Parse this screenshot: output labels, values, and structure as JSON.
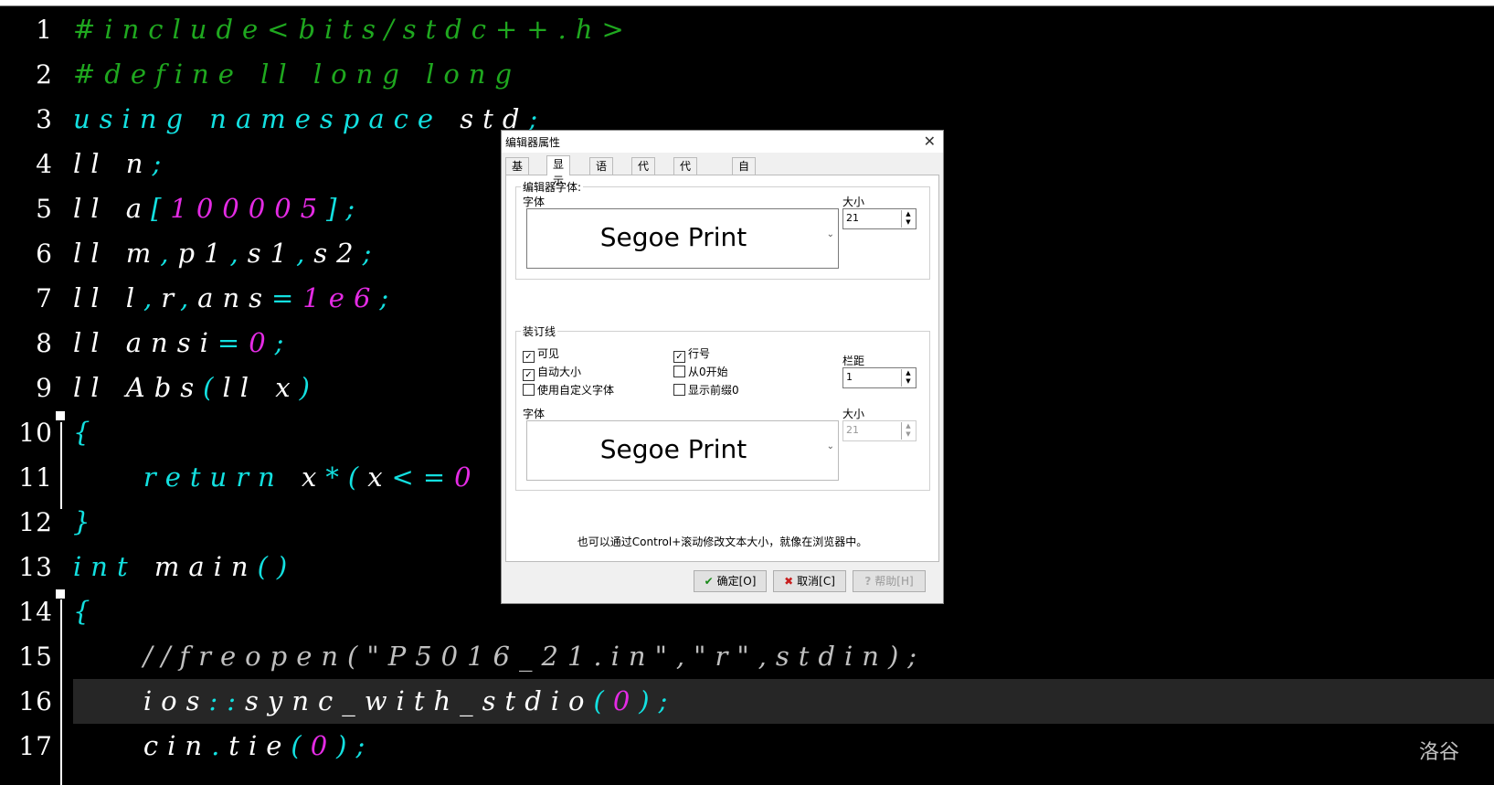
{
  "watermark": "洛谷",
  "code_lines": [
    {
      "num": "1",
      "tokens": [
        {
          "t": "#include<bits/stdc++.h>",
          "c": "pp"
        }
      ]
    },
    {
      "num": "2",
      "tokens": [
        {
          "t": "#define ll long long",
          "c": "pp"
        }
      ]
    },
    {
      "num": "3",
      "tokens": [
        {
          "t": "using namespace",
          "c": "kw"
        },
        {
          "t": " std",
          "c": "id"
        },
        {
          "t": ";",
          "c": "sym"
        }
      ]
    },
    {
      "num": "4",
      "tokens": [
        {
          "t": "ll n",
          "c": "id"
        },
        {
          "t": ";",
          "c": "sym"
        }
      ]
    },
    {
      "num": "5",
      "tokens": [
        {
          "t": "ll a",
          "c": "id"
        },
        {
          "t": "[",
          "c": "sym"
        },
        {
          "t": "100005",
          "c": "num"
        },
        {
          "t": "];",
          "c": "sym"
        }
      ]
    },
    {
      "num": "6",
      "tokens": [
        {
          "t": "ll m",
          "c": "id"
        },
        {
          "t": ",",
          "c": "sym"
        },
        {
          "t": "p1",
          "c": "id"
        },
        {
          "t": ",",
          "c": "sym"
        },
        {
          "t": "s1",
          "c": "id"
        },
        {
          "t": ",",
          "c": "sym"
        },
        {
          "t": "s2",
          "c": "id"
        },
        {
          "t": ";",
          "c": "sym"
        }
      ]
    },
    {
      "num": "7",
      "tokens": [
        {
          "t": "ll l",
          "c": "id"
        },
        {
          "t": ",",
          "c": "sym"
        },
        {
          "t": "r",
          "c": "id"
        },
        {
          "t": ",",
          "c": "sym"
        },
        {
          "t": "ans",
          "c": "id"
        },
        {
          "t": "=",
          "c": "sym"
        },
        {
          "t": "1e6",
          "c": "num"
        },
        {
          "t": ";",
          "c": "sym"
        }
      ]
    },
    {
      "num": "8",
      "tokens": [
        {
          "t": "ll ansi",
          "c": "id"
        },
        {
          "t": "=",
          "c": "sym"
        },
        {
          "t": "0",
          "c": "num"
        },
        {
          "t": ";",
          "c": "sym"
        }
      ]
    },
    {
      "num": "9",
      "tokens": [
        {
          "t": "ll Abs",
          "c": "id"
        },
        {
          "t": "(",
          "c": "sym"
        },
        {
          "t": "ll x",
          "c": "id"
        },
        {
          "t": ")",
          "c": "sym"
        }
      ]
    },
    {
      "num": "10",
      "tokens": [
        {
          "t": "{",
          "c": "sym"
        }
      ]
    },
    {
      "num": "11",
      "tokens": [
        {
          "t": "    return",
          "c": "kw"
        },
        {
          "t": " x",
          "c": "id"
        },
        {
          "t": "*(",
          "c": "sym"
        },
        {
          "t": "x",
          "c": "id"
        },
        {
          "t": "<=",
          "c": "sym"
        },
        {
          "t": "0",
          "c": "num"
        }
      ]
    },
    {
      "num": "12",
      "tokens": [
        {
          "t": "}",
          "c": "sym"
        }
      ]
    },
    {
      "num": "13",
      "tokens": [
        {
          "t": "int",
          "c": "kw"
        },
        {
          "t": " main",
          "c": "id"
        },
        {
          "t": "()",
          "c": "sym"
        }
      ]
    },
    {
      "num": "14",
      "tokens": [
        {
          "t": "{",
          "c": "sym"
        }
      ]
    },
    {
      "num": "15",
      "tokens": [
        {
          "t": "    //freopen(\"P5016_21.in\",\"r\",stdin);",
          "c": "cm"
        }
      ]
    },
    {
      "num": "16",
      "tokens": [
        {
          "t": "    ios",
          "c": "id"
        },
        {
          "t": "::",
          "c": "sym"
        },
        {
          "t": "sync_with_stdio",
          "c": "id"
        },
        {
          "t": "(",
          "c": "sym"
        },
        {
          "t": "0",
          "c": "num"
        },
        {
          "t": ");",
          "c": "sym"
        }
      ]
    },
    {
      "num": "17",
      "tokens": [
        {
          "t": "    cin",
          "c": "id"
        },
        {
          "t": ".",
          "c": "sym"
        },
        {
          "t": "tie",
          "c": "id"
        },
        {
          "t": "(",
          "c": "sym"
        },
        {
          "t": "0",
          "c": "num"
        },
        {
          "t": ");",
          "c": "sym"
        }
      ]
    }
  ],
  "dialog": {
    "title": "编辑器属性",
    "close": "✕",
    "tabs": [
      "基本",
      "显示",
      "语法",
      "代码",
      "代码补全",
      "自动保存"
    ],
    "active_tab": "显示",
    "editor_font": {
      "group_label": "编辑器字体:",
      "font_label": "字体",
      "font_value": "Segoe Print",
      "size_label": "大小",
      "size_value": "21"
    },
    "gutter": {
      "group_label": "装订线",
      "visible": {
        "label": "可见",
        "checked": true
      },
      "auto_size": {
        "label": "自动大小",
        "checked": true
      },
      "custom_font": {
        "label": "使用自定义字体",
        "checked": false
      },
      "line_numbers": {
        "label": "行号",
        "checked": true
      },
      "start_at_zero": {
        "label": "从0开始",
        "checked": false
      },
      "leading_zeros": {
        "label": "显示前缀0",
        "checked": false
      },
      "margin_label": "栏距",
      "margin_value": "1",
      "font_label": "字体",
      "font_value": "Segoe Print",
      "size_label": "大小",
      "size_value": "21"
    },
    "hint": "也可以通过Control+滚动修改文本大小，就像在浏览器中。",
    "buttons": {
      "ok": "确定[O]",
      "cancel": "取消[C]",
      "help": "帮助[H]"
    }
  }
}
